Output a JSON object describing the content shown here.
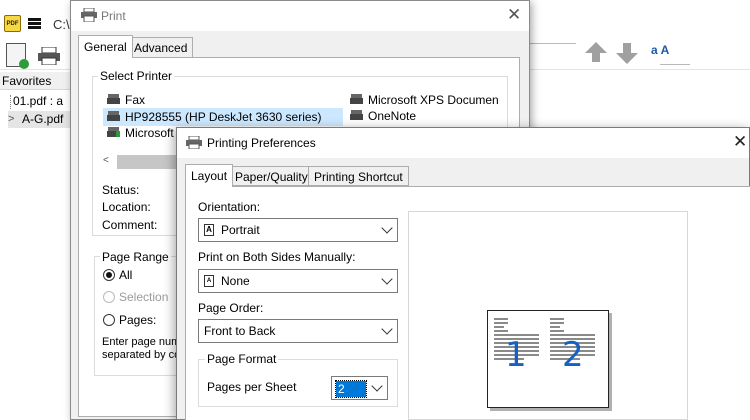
{
  "app": {
    "logo_text": "PDF",
    "path": "C:\\",
    "font_size_icon": "a A",
    "favorites_label": "Favorites",
    "tree": [
      {
        "label": "01.pdf : a"
      },
      {
        "label": "A-G.pdf",
        "chevron": ">"
      }
    ]
  },
  "print_dialog": {
    "title": "Print",
    "close": "✕",
    "tabs": [
      {
        "label": "General",
        "active": true
      },
      {
        "label": "Advanced",
        "active": false
      }
    ],
    "select_printer": {
      "label": "Select Printer",
      "printers_left": [
        {
          "label": "Fax"
        },
        {
          "label": "HP928555 (HP DeskJet 3630 series)",
          "selected": true
        },
        {
          "label": "Microsoft"
        }
      ],
      "printers_right": [
        {
          "label": "Microsoft XPS Documen"
        },
        {
          "label": "OneNote"
        }
      ],
      "scroll_left": "<",
      "status_label": "Status:",
      "location_label": "Location:",
      "comment_label": "Comment:"
    },
    "page_range": {
      "label": "Page Range",
      "all": "All",
      "selection": "Selection",
      "pages": "Pages:",
      "help_line1": "Enter page numb",
      "help_line2": "separated by co"
    }
  },
  "prefs_dialog": {
    "title": "Printing Preferences",
    "close": "✕",
    "tabs": [
      {
        "label": "Layout",
        "active": true
      },
      {
        "label": "Paper/Quality",
        "active": false
      },
      {
        "label": "Printing Shortcut",
        "active": false
      }
    ],
    "orientation": {
      "label": "Orientation:",
      "value": "Portrait",
      "icon_glyph": "A"
    },
    "both_sides": {
      "label": "Print on Both Sides Manually:",
      "value": "None",
      "icon_glyph": "A"
    },
    "page_order": {
      "label": "Page Order:",
      "value": "Front to Back"
    },
    "page_format": {
      "label": "Page Format",
      "pages_per_sheet_label": "Pages per Sheet",
      "pages_per_sheet_value": "2"
    },
    "preview": {
      "page1": "1",
      "page2": "2"
    }
  },
  "colors": {
    "accent": "#0078d7",
    "selected_row": "#cce8ff",
    "preview_numbers": "#1560c4"
  }
}
